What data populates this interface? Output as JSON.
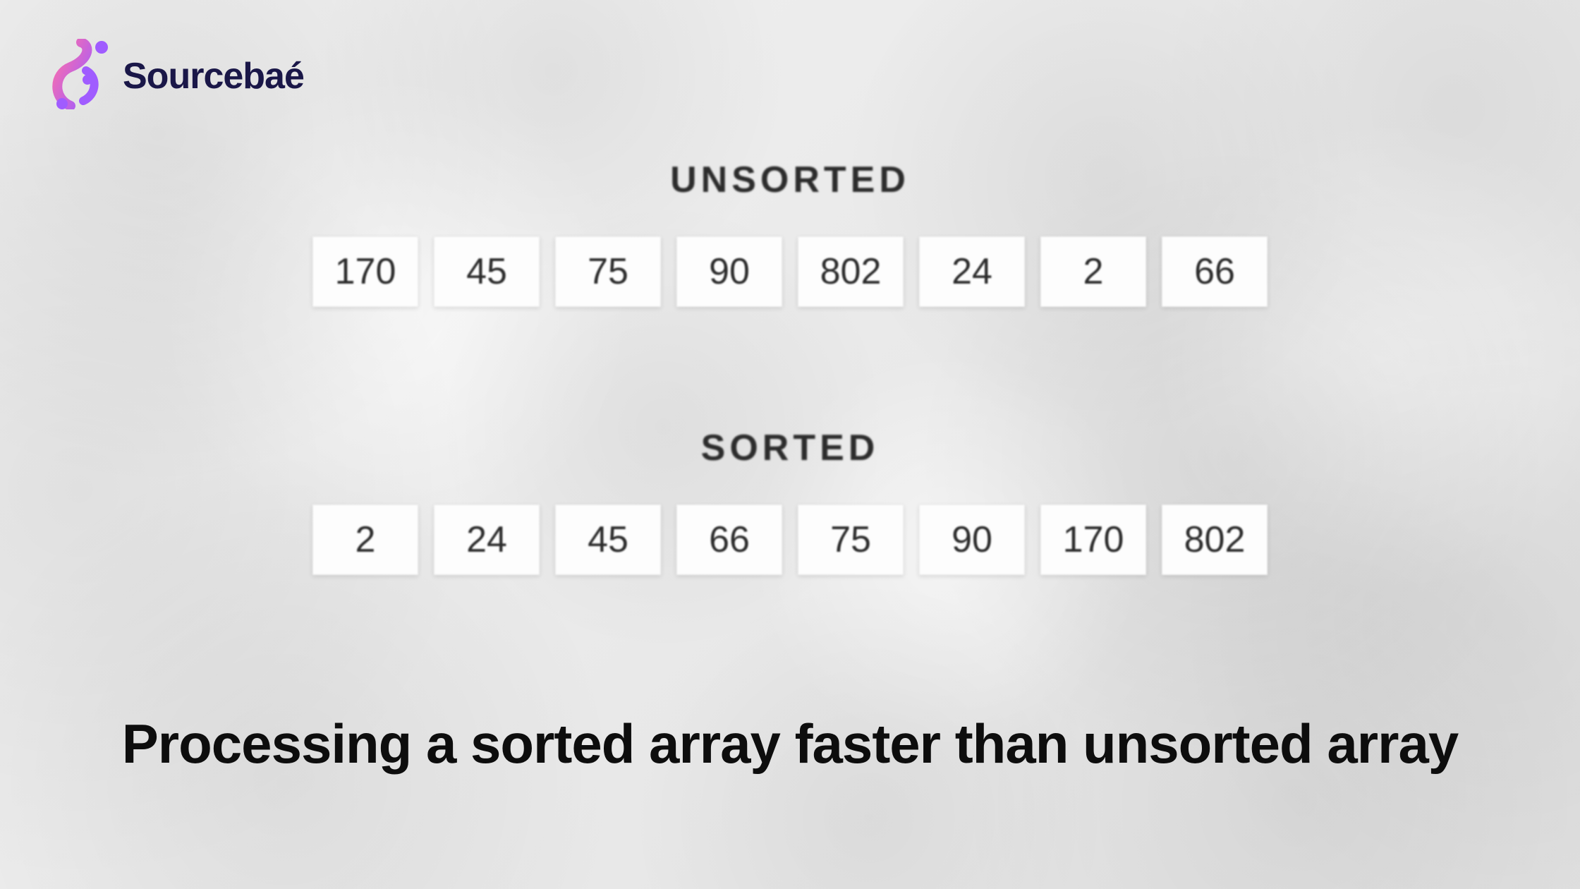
{
  "brand": {
    "name": "Sourcebaé"
  },
  "unsorted": {
    "label": "UNSORTED",
    "values": [
      170,
      45,
      75,
      90,
      802,
      24,
      2,
      66
    ]
  },
  "sorted": {
    "label": "SORTED",
    "values": [
      2,
      24,
      45,
      66,
      75,
      90,
      170,
      802
    ]
  },
  "caption": "Processing a sorted array faster than unsorted array",
  "chart_data": {
    "type": "table",
    "title": "Processing a sorted array faster than unsorted array",
    "series": [
      {
        "name": "UNSORTED",
        "values": [
          170,
          45,
          75,
          90,
          802,
          24,
          2,
          66
        ]
      },
      {
        "name": "SORTED",
        "values": [
          2,
          24,
          45,
          66,
          75,
          90,
          170,
          802
        ]
      }
    ]
  }
}
